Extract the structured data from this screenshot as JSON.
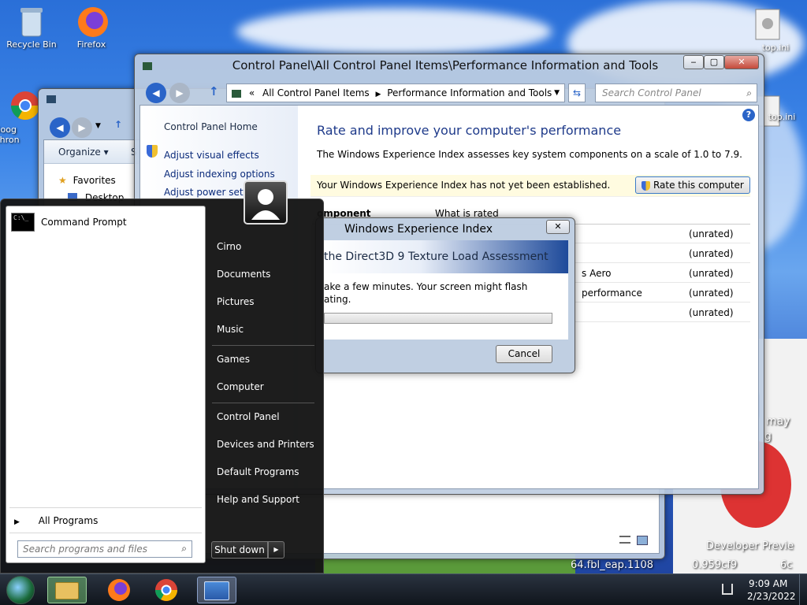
{
  "desktop": {
    "icons": [
      {
        "label": "Recycle Bin",
        "icon": "recycle-bin-icon"
      },
      {
        "label": "Firefox",
        "icon": "firefox-icon"
      },
      {
        "label": "Goog Chron",
        "icon": "chrome-icon"
      }
    ],
    "right_icons": [
      {
        "label": "top.ini"
      },
      {
        "label": "top.ini"
      }
    ],
    "watermark": {
      "line1": "may",
      "line2": "g",
      "build_title": "Developer Previe",
      "build_string": "64.fbl_eap.1108",
      "build_string2": "0.959cf9",
      "build_string3": "6c"
    }
  },
  "back_window": {
    "organize_label": "Organize ▾",
    "s_label": "S",
    "favorites_label": "Favorites",
    "desktop_label": "Desktop"
  },
  "control_panel": {
    "title": "Control Panel\\All Control Panel Items\\Performance Information and Tools",
    "breadcrumb_sep": "«",
    "breadcrumb": [
      "All Control Panel Items",
      "Performance Information and Tools"
    ],
    "search_placeholder": "Search Control Panel",
    "left_pane": {
      "home": "Control Panel Home",
      "links": [
        "Adjust visual effects",
        "Adjust indexing options",
        "Adjust power settin"
      ]
    },
    "heading": "Rate and improve your computer's performance",
    "description": "The Windows Experience Index assesses key system components on a scale of 1.0 to 7.9.",
    "notice": "Your Windows Experience Index has not yet been established.",
    "rate_button": "Rate this computer",
    "table": {
      "col_component": "omponent",
      "col_what": "What is rated",
      "rows": [
        {
          "what": "",
          "score": "(unrated)"
        },
        {
          "what": "",
          "score": "(unrated)"
        },
        {
          "what": "s Aero",
          "score": "(unrated)"
        },
        {
          "what": "performance",
          "score": "(unrated)"
        },
        {
          "what": "",
          "score": "(unrated)"
        }
      ]
    }
  },
  "dialog": {
    "title": "Windows Experience Index",
    "header": "the Direct3D 9 Texture Load Assessment",
    "message_line1": "ake a few minutes. Your screen might flash",
    "message_line2": "ating.",
    "progress": 0.0,
    "cancel_label": "Cancel"
  },
  "start_menu": {
    "pinned": [
      {
        "label": "Command Prompt",
        "icon": "command-prompt-icon"
      }
    ],
    "all_programs": "All Programs",
    "search_placeholder": "Search programs and files",
    "right_items": [
      "Cirno",
      "Documents",
      "Pictures",
      "Music",
      "Games",
      "Computer",
      "Control Panel",
      "Devices and Printers",
      "Default Programs",
      "Help and Support"
    ],
    "shutdown_label": "Shut down"
  },
  "taskbar": {
    "items": [
      "start-orb-icon",
      "explorer-icon",
      "firefox-icon",
      "chrome-icon",
      "control-panel-icon"
    ],
    "time": "9:09 AM",
    "date": "2/23/2022"
  },
  "colors": {
    "link": "#0a2a7a",
    "notice_bg": "#fffbe0",
    "dialog_header": "#1e4a9a"
  }
}
